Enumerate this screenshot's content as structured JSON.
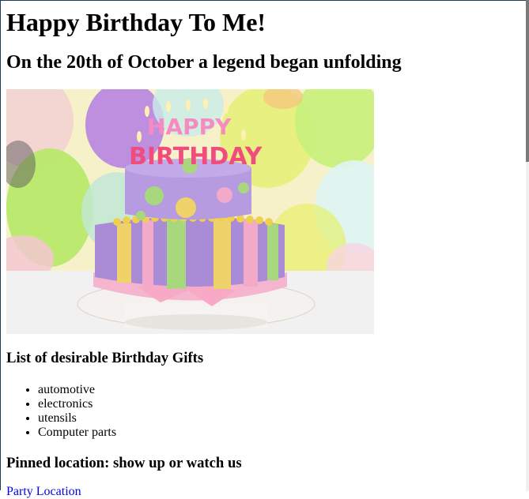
{
  "page": {
    "title": "Happy Birthday To Me!",
    "subtitle": "On the 20th of October a legend began unfolding"
  },
  "hero_image": {
    "alt": "Birthday cake with Happy Birthday candles",
    "candle_text_line1": "HAPPY",
    "candle_text_line2": "BIRTHDAY",
    "colors": {
      "cake_top": "#b79be0",
      "cake_bottom_stripe_a": "#a98bd6",
      "stripe_yellow": "#efd36a",
      "stripe_green": "#a8d77e",
      "stripe_pink": "#f3a9c9",
      "board": "#f7f3ef",
      "background_bokeh": "#f3f7c9"
    }
  },
  "gifts": {
    "title": "List of desirable Birthday Gifts",
    "items": [
      "automotive",
      "electronics",
      "utensils",
      "Computer parts"
    ]
  },
  "location": {
    "title": "Pinned location: show up or watch us",
    "link_text": "Party Location"
  }
}
